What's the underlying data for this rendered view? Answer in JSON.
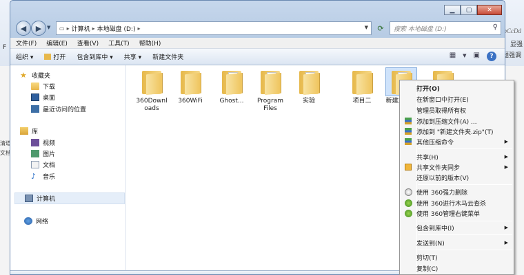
{
  "address": {
    "segments": [
      "计算机",
      "本地磁盘 (D:)"
    ]
  },
  "search": {
    "placeholder": "搜索 本地磁盘 (D:)"
  },
  "menubar": [
    "文件(F)",
    "编辑(E)",
    "查看(V)",
    "工具(T)",
    "帮助(H)"
  ],
  "toolbar": {
    "organize": "组织 ▾",
    "open": "打开",
    "include": "包含到库中 ▾",
    "share": "共享 ▾",
    "new_folder": "新建文件夹"
  },
  "nav": {
    "favorites": "收藏夹",
    "downloads": "下载",
    "desktop": "桌面",
    "recent": "最近访问的位置",
    "libraries": "库",
    "videos": "视频",
    "pictures": "图片",
    "documents": "文档",
    "music": "音乐",
    "computer": "计算机",
    "network": "网络"
  },
  "files": [
    "360Downloads",
    "360WiFi",
    "Ghost...",
    "Program Files",
    "实验",
    "项目二",
    "新建文件夹",
    ""
  ],
  "context_menu": {
    "open": "打开(O)",
    "open_new_window": "在新窗口中打开(E)",
    "admin_owner": "管理员取得所有权",
    "add_archive": "添加到压缩文件(A) ...",
    "add_zip": "添加到 \"新建文件夹.zip\"(T)",
    "other_compress": "其他压缩命令",
    "share": "共享(H)",
    "share_sync": "共享文件夹同步",
    "restore": "还原以前的版本(V)",
    "force_delete": "使用 360强力删除",
    "trojan_scan": "使用 360进行木马云查杀",
    "manage_menu": "使用 360管理右键菜单",
    "include_lib": "包含到库中(I)",
    "send_to": "发送到(N)",
    "cut": "剪切(T)",
    "copy": "复制(C)"
  },
  "background": {
    "ribbon_text": "bCcDd",
    "ribbon_text2": "显强",
    "ribbon_text3": "题强调",
    "side1": "清道",
    "side2": "文档中",
    "mark": "F"
  }
}
